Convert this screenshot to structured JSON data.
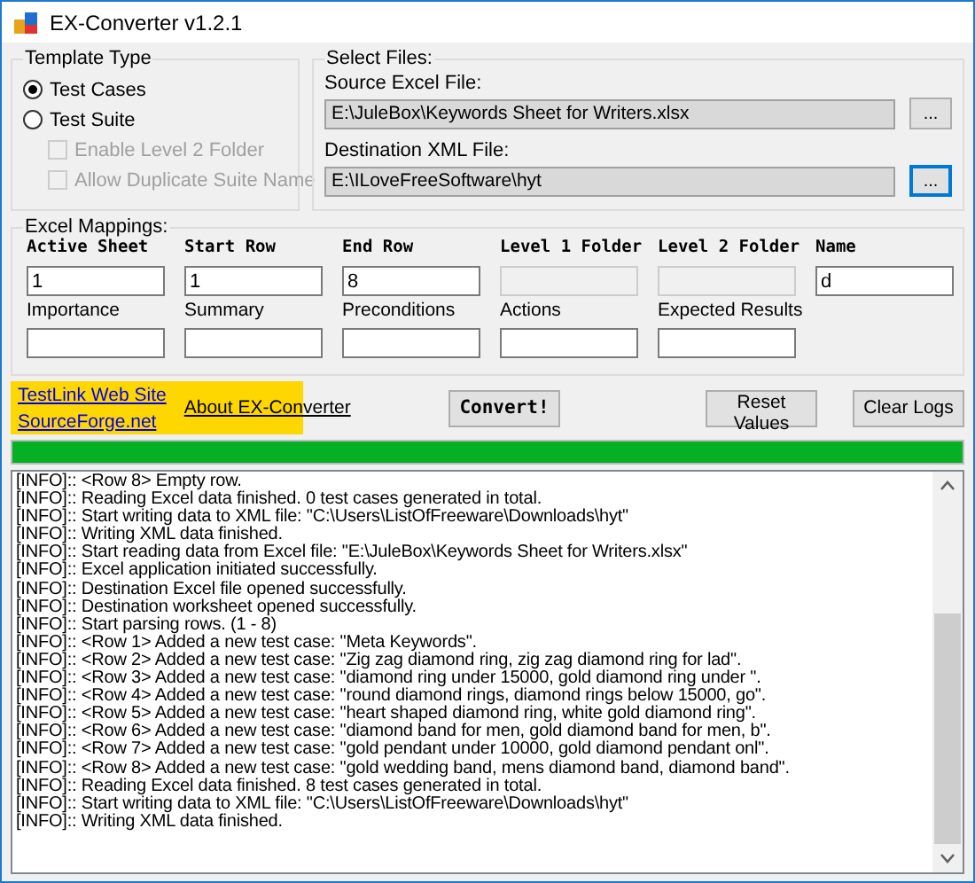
{
  "window": {
    "title": "EX-Converter v1.2.1"
  },
  "template_type": {
    "label": "Template Type",
    "options": [
      {
        "label": "Test Cases",
        "selected": true
      },
      {
        "label": "Test Suite",
        "selected": false
      }
    ],
    "checkboxes": [
      {
        "label": "Enable Level 2 Folder",
        "checked": false,
        "disabled": true
      },
      {
        "label": "Allow Duplicate Suite Name",
        "checked": false,
        "disabled": true
      }
    ]
  },
  "select_files": {
    "label": "Select Files:",
    "files": [
      {
        "label": "Source Excel File:",
        "value": "E:\\JuleBox\\Keywords Sheet for Writers.xlsx",
        "button": "...",
        "focused": false
      },
      {
        "label": "Destination XML File:",
        "value": "E:\\ILoveFreeSoftware\\hyt",
        "button": "...",
        "focused": true
      }
    ]
  },
  "excel_mappings": {
    "label": "Excel Mappings:",
    "fields": [
      {
        "label": "Active Sheet",
        "value": "1",
        "bold": true,
        "disabled": false
      },
      {
        "label": "Start Row",
        "value": "1",
        "bold": true,
        "disabled": false
      },
      {
        "label": "End Row",
        "value": "8",
        "bold": true,
        "disabled": false
      },
      {
        "label": "Level 1 Folder",
        "bold": true,
        "disabled": true
      },
      {
        "label": "Level 2 Folder",
        "bold": true,
        "disabled": true
      },
      {
        "label": "Name",
        "value": "d",
        "bold": true,
        "disabled": false
      },
      {
        "label": "Importance",
        "bold": false,
        "disabled": false
      },
      {
        "label": "Summary",
        "bold": false,
        "disabled": false
      },
      {
        "label": "Preconditions",
        "bold": false,
        "disabled": false
      },
      {
        "label": "Actions",
        "bold": false,
        "disabled": false
      },
      {
        "label": "Expected Results",
        "bold": false,
        "disabled": false
      }
    ]
  },
  "links": [
    {
      "label": "TestLink Web Site",
      "color": "#0000ee"
    },
    {
      "label": "SourceForge.net",
      "color": "#0000ee"
    },
    {
      "label": "About EX-Converter",
      "color": "#000000"
    }
  ],
  "buttons": [
    {
      "label": "Convert!",
      "kind": "primary"
    },
    {
      "label": "Reset Values",
      "kind": "normal"
    },
    {
      "label": "Clear Logs",
      "kind": "normal"
    }
  ],
  "progress": {
    "level": 1
  },
  "log": [
    "[INFO]:: <Row 8> Empty row.",
    "[INFO]:: Reading Excel data finished. 0 test cases generated in total.",
    "[INFO]:: Start writing data to XML file: \"C:\\Users\\ListOfFreeware\\Downloads\\hyt\"",
    "[INFO]:: Writing XML data finished.",
    "[INFO]:: Start reading data from Excel file: \"E:\\JuleBox\\Keywords Sheet for Writers.xlsx\"",
    "[INFO]:: Excel application initiated successfully.",
    "[INFO]:: Destination Excel file opened successfully.",
    "[INFO]:: Destination worksheet opened successfully.",
    "[INFO]:: Start parsing rows. (1 - 8)",
    "[INFO]:: <Row 1> Added a new test case: \"Meta Keywords\".",
    "[INFO]:: <Row 2> Added a new test case: \"Zig zag diamond ring, zig zag diamond ring for lad\".",
    "[INFO]:: <Row 3> Added a new test case: \"diamond ring under 15000, gold diamond ring under \".",
    "[INFO]:: <Row 4> Added a new test case: \"round diamond rings, diamond rings below 15000, go\".",
    "[INFO]:: <Row 5> Added a new test case: \"heart shaped diamond ring, white gold diamond ring\".",
    "[INFO]:: <Row 6> Added a new test case: \"diamond band for men, gold diamond band for men, b\".",
    "[INFO]:: <Row 7> Added a new test case: \"gold pendant under 10000, gold diamond pendant onl\".",
    "[INFO]:: <Row 8> Added a new test case: \"gold wedding band, mens diamond band, diamond band\".",
    "[INFO]:: Reading Excel data finished. 8 test cases generated in total.",
    "[INFO]:: Start writing data to XML file: \"C:\\Users\\ListOfFreeware\\Downloads\\hyt\"",
    "[INFO]:: Writing XML data finished."
  ]
}
